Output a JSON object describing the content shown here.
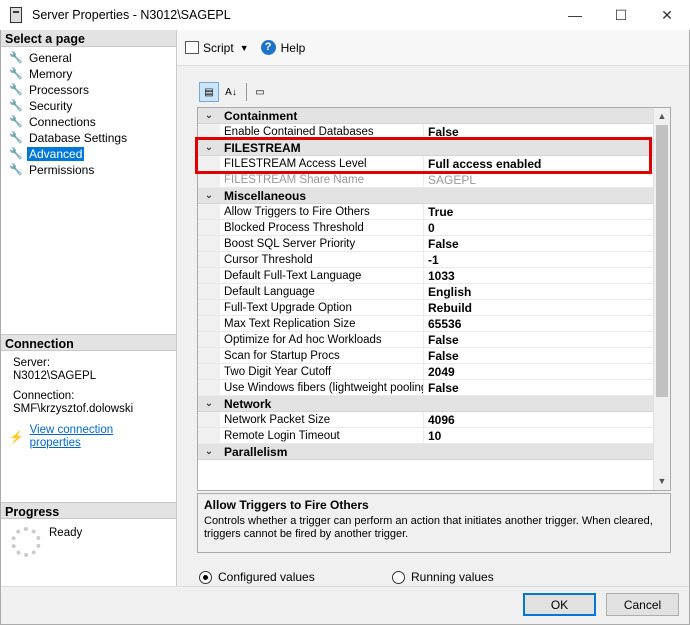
{
  "window": {
    "title": "Server Properties - N3012\\SAGEPL",
    "minimize": "—",
    "maximize": "☐",
    "close": "✕"
  },
  "sidebar": {
    "header": "Select a page",
    "items": [
      {
        "label": "General",
        "icon": "wrench-icon"
      },
      {
        "label": "Memory",
        "icon": "wrench-icon"
      },
      {
        "label": "Processors",
        "icon": "wrench-icon"
      },
      {
        "label": "Security",
        "icon": "wrench-icon"
      },
      {
        "label": "Connections",
        "icon": "wrench-icon"
      },
      {
        "label": "Database Settings",
        "icon": "wrench-icon"
      },
      {
        "label": "Advanced",
        "icon": "wrench-icon",
        "selected": true
      },
      {
        "label": "Permissions",
        "icon": "wrench-icon"
      }
    ]
  },
  "connection": {
    "header": "Connection",
    "server_label": "Server:",
    "server_value": "N3012\\SAGEPL",
    "connection_label": "Connection:",
    "connection_value": "SMF\\krzysztof.dolowski",
    "view_link": "View connection properties"
  },
  "progress": {
    "header": "Progress",
    "status": "Ready"
  },
  "toolbar": {
    "script_label": "Script",
    "help_label": "Help"
  },
  "grid": {
    "groups": [
      {
        "name": "Containment",
        "rows": [
          {
            "name": "Enable Contained Databases",
            "value": "False"
          }
        ]
      },
      {
        "name": "FILESTREAM",
        "rows": [
          {
            "name": "FILESTREAM Access Level",
            "value": "Full access enabled"
          },
          {
            "name": "FILESTREAM Share Name",
            "value": "SAGEPL",
            "disabled": true
          }
        ]
      },
      {
        "name": "Miscellaneous",
        "rows": [
          {
            "name": "Allow Triggers to Fire Others",
            "value": "True"
          },
          {
            "name": "Blocked Process Threshold",
            "value": "0"
          },
          {
            "name": "Boost SQL Server Priority",
            "value": "False"
          },
          {
            "name": "Cursor Threshold",
            "value": "-1"
          },
          {
            "name": "Default Full-Text Language",
            "value": "1033"
          },
          {
            "name": "Default Language",
            "value": "English"
          },
          {
            "name": "Full-Text Upgrade Option",
            "value": "Rebuild"
          },
          {
            "name": "Max Text Replication Size",
            "value": "65536"
          },
          {
            "name": "Optimize for Ad hoc Workloads",
            "value": "False"
          },
          {
            "name": "Scan for Startup Procs",
            "value": "False"
          },
          {
            "name": "Two Digit Year Cutoff",
            "value": "2049"
          },
          {
            "name": "Use Windows fibers (lightweight pooling)",
            "value": "False"
          }
        ]
      },
      {
        "name": "Network",
        "rows": [
          {
            "name": "Network Packet Size",
            "value": "4096"
          },
          {
            "name": "Remote Login Timeout",
            "value": "10"
          }
        ]
      },
      {
        "name": "Parallelism",
        "rows": []
      }
    ]
  },
  "description": {
    "title": "Allow Triggers to Fire Others",
    "text": "Controls whether a trigger can perform an action that initiates another trigger. When cleared, triggers cannot be fired by another trigger."
  },
  "radios": {
    "configured": "Configured values",
    "running": "Running values",
    "selected": "configured"
  },
  "buttons": {
    "ok": "OK",
    "cancel": "Cancel"
  },
  "colors": {
    "selection": "#0078d7",
    "highlight_box": "#e00000",
    "link": "#0066cc"
  }
}
